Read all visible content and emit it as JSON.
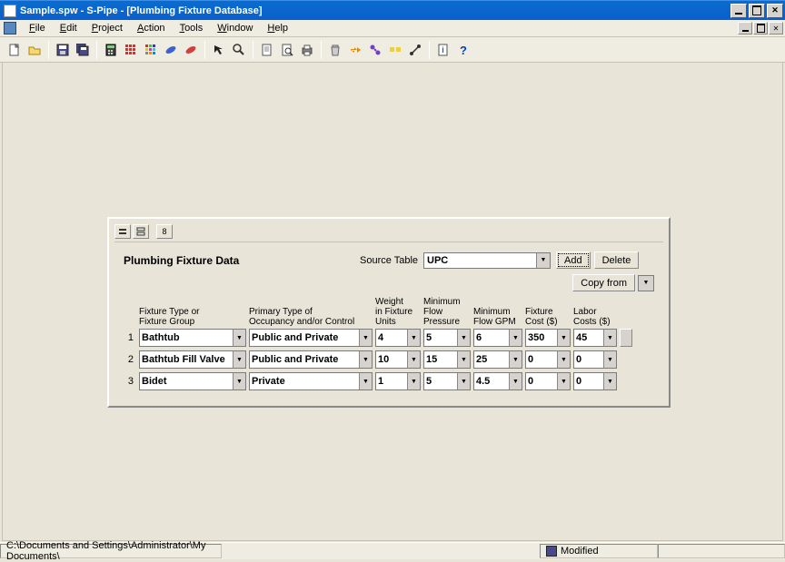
{
  "window": {
    "title": "Sample.spw - S-Pipe - [Plumbing Fixture Database]"
  },
  "menus": [
    "File",
    "Edit",
    "Project",
    "Action",
    "Tools",
    "Window",
    "Help"
  ],
  "panel": {
    "title": "Plumbing Fixture Data",
    "source_label": "Source Table",
    "source_value": "UPC",
    "add_btn": "Add",
    "delete_btn": "Delete",
    "copyfrom_btn": "Copy from",
    "small_tab": "8",
    "columns": {
      "fixture": "Fixture Type or\nFixture Group",
      "occupancy": "Primary Type of\nOccupancy and/or Control",
      "weight": "Weight\nin Fixture\nUnits",
      "minflow": "Minimum\nFlow\nPressure",
      "mingpm": "Minimum\nFlow GPM",
      "fixcost": "Fixture\nCost ($)",
      "labcost": "Labor\nCosts ($)"
    },
    "rows": [
      {
        "n": "1",
        "fixture": "Bathtub",
        "occ": "Public and Private",
        "w": "4",
        "mf": "5",
        "mg": "6",
        "fc": "350",
        "lc": "45"
      },
      {
        "n": "2",
        "fixture": "Bathtub Fill Valve",
        "occ": "Public and Private",
        "w": "10",
        "mf": "15",
        "mg": "25",
        "fc": "0",
        "lc": "0"
      },
      {
        "n": "3",
        "fixture": "Bidet",
        "occ": "Private",
        "w": "1",
        "mf": "5",
        "mg": "4.5",
        "fc": "0",
        "lc": "0"
      }
    ]
  },
  "status": {
    "path": "C:\\Documents and Settings\\Administrator\\My Documents\\",
    "modified": "Modified"
  }
}
